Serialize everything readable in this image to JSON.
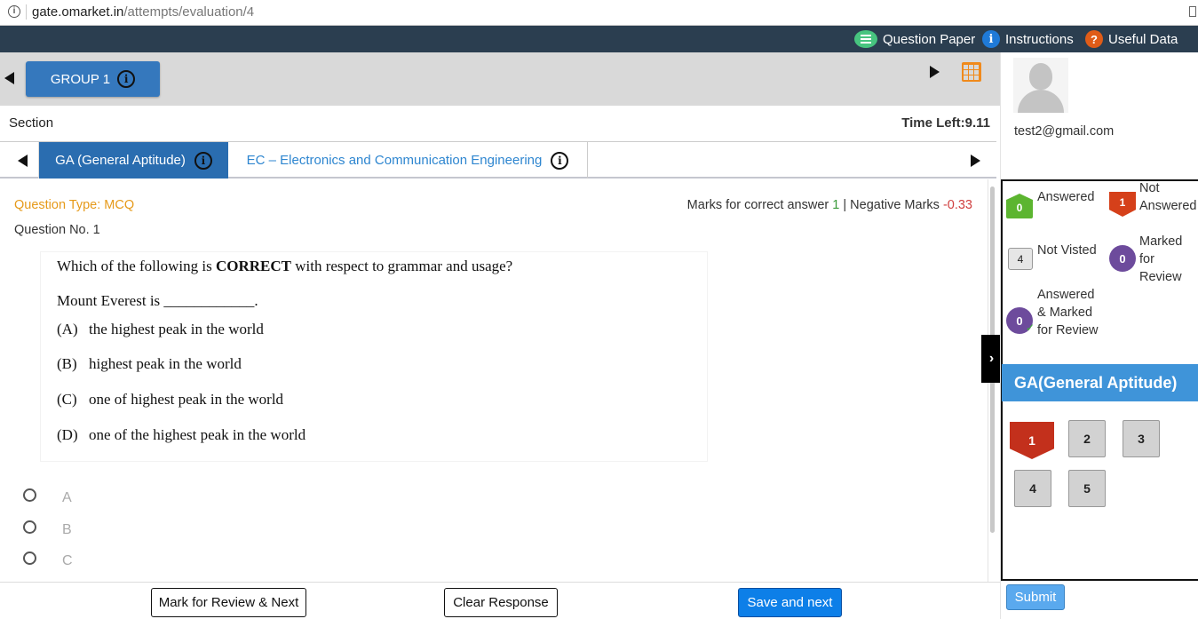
{
  "browser": {
    "url_domain": "gate.omarket.in",
    "url_path": "/attempts/evaluation/4"
  },
  "topbar": {
    "question_paper": "Question Paper",
    "instructions": "Instructions",
    "instructions_icon": "i",
    "useful_data": "Useful Data",
    "useful_data_icon": "?"
  },
  "group": {
    "label": "GROUP 1",
    "info_icon": "i"
  },
  "section": {
    "label": "Section",
    "time_left": "Time Left:9.11"
  },
  "tabs": [
    {
      "label": "GA (General Aptitude)",
      "active": true,
      "info_icon": "i"
    },
    {
      "label": "EC – Electronics and Communication Engineering",
      "active": false,
      "info_icon": "i"
    }
  ],
  "question": {
    "type_label": "Question Type: MCQ",
    "marks_prefix": "Marks for correct answer",
    "marks_correct": "1",
    "marks_sep": "|",
    "negative_prefix": "Negative Marks",
    "marks_negative": "-0.33",
    "number_label": "Question No. 1",
    "stem_before": "Which of the following is",
    "stem_bold": "CORRECT",
    "stem_after": "with respect to grammar and usage?",
    "sentence": "Mount Everest is ____________.",
    "options": [
      {
        "key": "(A)",
        "text": "the highest peak in the world"
      },
      {
        "key": "(B)",
        "text": "highest peak in the world"
      },
      {
        "key": "(C)",
        "text": "one of highest peak in the world"
      },
      {
        "key": "(D)",
        "text": "one of the highest peak in the world"
      }
    ],
    "answer_choices": [
      "A",
      "B",
      "C"
    ]
  },
  "bottom": {
    "mark_review": "Mark for Review & Next",
    "clear": "Clear Response",
    "save_next": "Save and next"
  },
  "profile": {
    "email": "test2@gmail.com"
  },
  "legend": {
    "answered": {
      "count": "0",
      "label": "Answered"
    },
    "not_answered": {
      "count": "1",
      "label_line1": "Not",
      "label_line2": "Answered"
    },
    "not_visited": {
      "count": "4",
      "label": "Not Visted"
    },
    "marked": {
      "count": "0",
      "label_line1": "Marked",
      "label_line2": "for Review"
    },
    "answered_marked": {
      "count": "0",
      "label_line1": "Answered",
      "label_line2": "& Marked",
      "label_line3": "for Review"
    }
  },
  "palette": {
    "section_title": "GA(General Aptitude)",
    "questions": [
      "1",
      "2",
      "3",
      "4",
      "5"
    ]
  },
  "submit": "Submit",
  "collapse_glyph": "›",
  "colors": {
    "topbar": "#2b3e50",
    "group_button": "#3578bd",
    "active_tab": "#2a6db0",
    "tab_link": "#2e86d0",
    "question_type": "#e69a1a",
    "answered_green": "#5cb530",
    "not_answered_red": "#d5401a",
    "marked_purple": "#6d4b9c",
    "section_header": "#3f94d9",
    "save_button": "#0d7fe8"
  }
}
